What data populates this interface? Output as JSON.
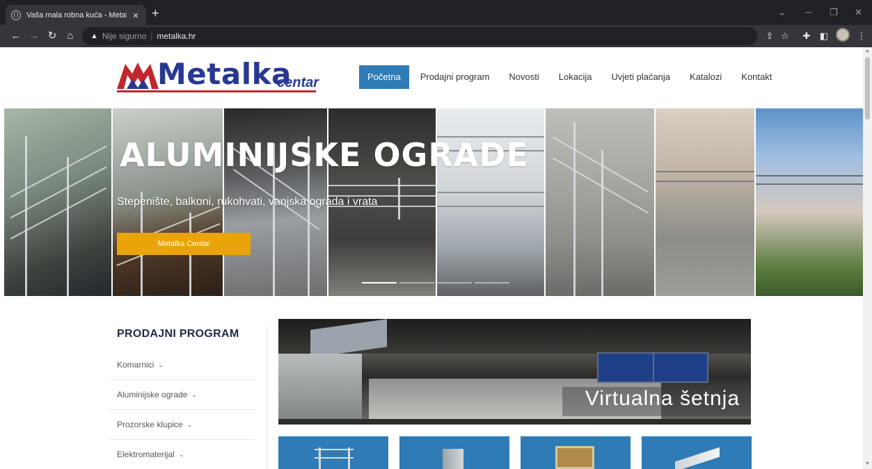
{
  "browser": {
    "tab_title": "Vaša mala robna kuća - Metalka",
    "new_tab": "+",
    "omnibox": {
      "warning_icon": "▲",
      "insecure_label": "Nije sigurno",
      "url": "metalka.hr"
    }
  },
  "site": {
    "logo": {
      "word": "Metalka",
      "sub": "centar"
    },
    "nav": {
      "items": [
        "Početna",
        "Prodajni program",
        "Novosti",
        "Lokacija",
        "Uvjeti plaćanja",
        "Katalozi",
        "Kontakt"
      ],
      "active_index": 0
    },
    "hero": {
      "title": "ALUMINIJSKE OGRADE",
      "subtitle": "Stepenište, balkoni, rukohvati, vanjska ograda i vrata",
      "button_label": "Metalka Centar"
    },
    "sidebar": {
      "title": "PRODAJNI PROGRAM",
      "items": [
        "Komarnici",
        "Aluminijske ograde",
        "Prozorske klupice",
        "Elektromaterijal"
      ]
    },
    "tour": {
      "caption": "Virtualna šetnja"
    }
  },
  "colors": {
    "accent_blue": "#2e7bb5",
    "button_yellow": "#e8a409",
    "logo_blue": "#283891",
    "logo_red": "#c1272d"
  }
}
